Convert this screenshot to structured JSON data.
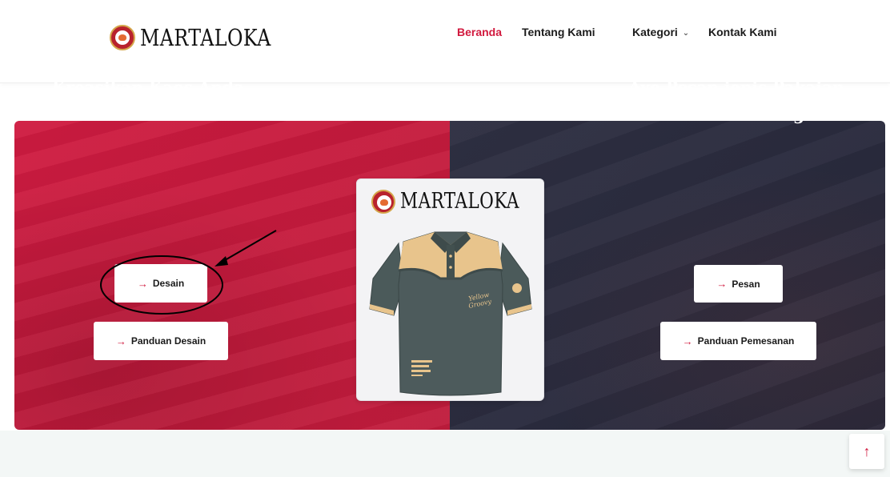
{
  "brand": {
    "name": "MARTALOKA"
  },
  "nav": {
    "items": [
      {
        "label": "Beranda",
        "active": true
      },
      {
        "label": "Tentang Kami"
      },
      {
        "label": "Kategori",
        "dropdown": true
      },
      {
        "label": "Kontak Kami"
      }
    ]
  },
  "hero": {
    "left": {
      "title": "Kreasikan Kaos Anda di sini",
      "buttons": [
        {
          "label": "Desain"
        },
        {
          "label": "Panduan Desain"
        }
      ]
    },
    "right": {
      "title": "Ayo Pesan jenis Pakaian Anda Sekarang",
      "buttons": [
        {
          "label": "Pesan"
        },
        {
          "label": "Panduan Pemesanan"
        }
      ]
    },
    "card": {
      "brand": "MARTALOKA"
    }
  },
  "icons": {
    "arrow": "→",
    "chevron": "⌄",
    "scroll_top": "↑"
  },
  "colors": {
    "accent": "#d1193e",
    "hero_left": "#cf1b41",
    "hero_right": "#2f3043",
    "shirt_body": "#4b5a5a",
    "shirt_yoke": "#e8c48c"
  }
}
